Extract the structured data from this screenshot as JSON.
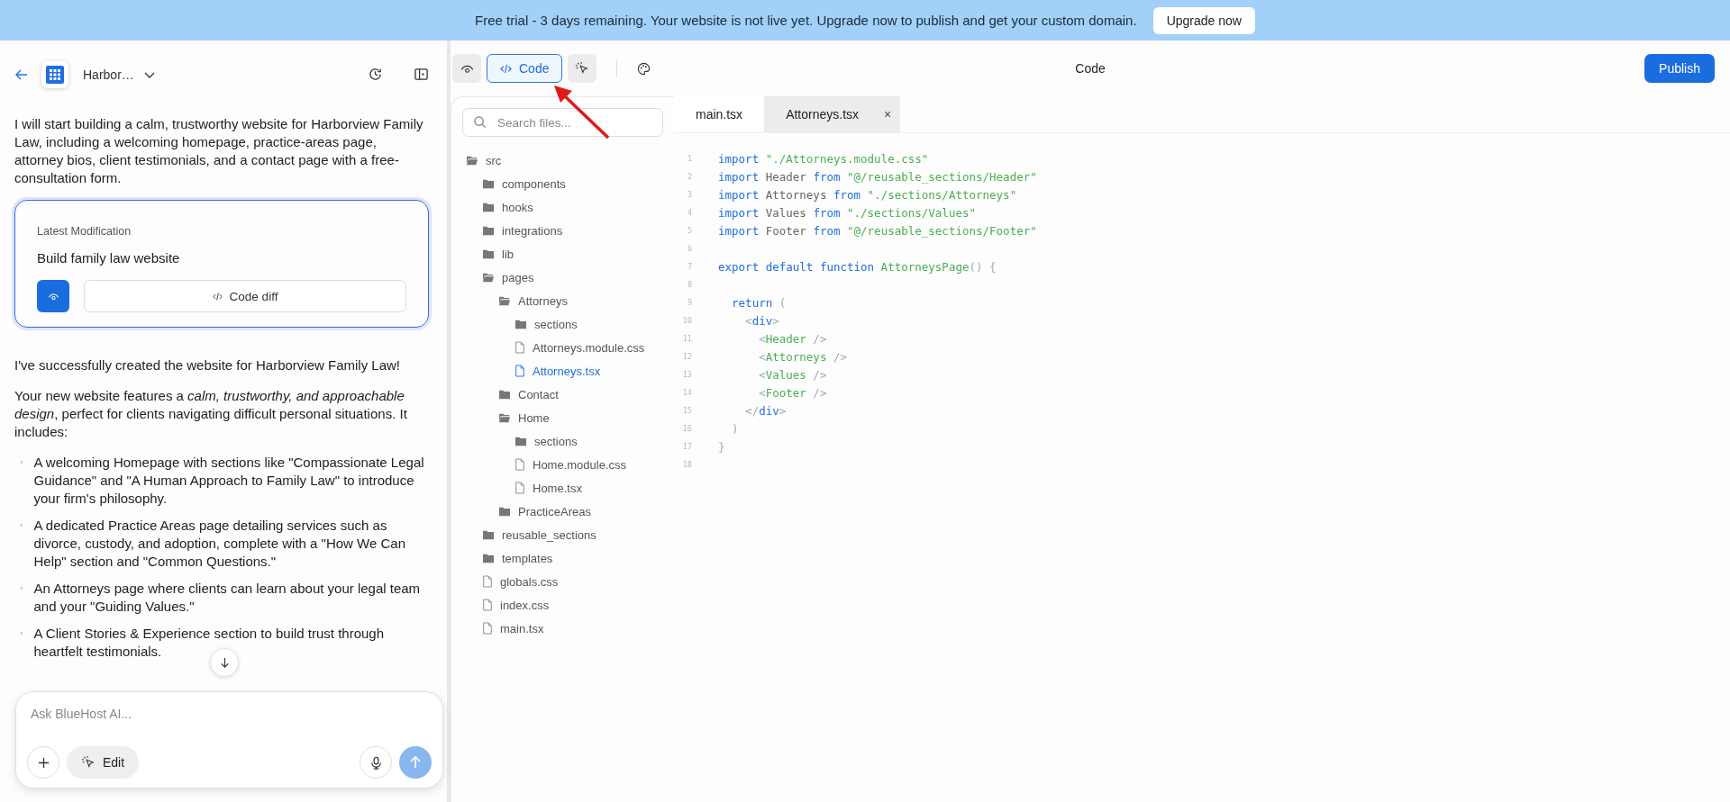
{
  "banner": {
    "message": "Free trial - 3 days remaining. Your website is not live yet. Upgrade now to publish and get your custom domain.",
    "button": "Upgrade now"
  },
  "project": {
    "name": "Harbor…"
  },
  "chat": {
    "intro": "I will start building a calm, trustworthy website for Harborview Family Law, including a welcoming homepage, practice-areas page, attorney bios, client testimonials, and a contact page with a free-consultation form.",
    "modification": {
      "label": "Latest Modification",
      "title": "Build family law website",
      "diff_button": "Code diff"
    },
    "paragraphs": [
      "I've successfully created the website for Harborview Family Law!",
      "Your new website features a *calm, trustworthy, and approachable design*, perfect for clients navigating difficult personal situations. It includes:"
    ],
    "bullet_glyph": "•",
    "bullets": [
      "A welcoming Homepage with sections like \"Compassionate Legal Guidance\" and \"A Human Approach to Family Law\" to introduce your firm's philosophy.",
      "A dedicated Practice Areas page detailing services such as divorce, custody, and adoption, complete with a \"How We Can Help\" section and \"Common Questions.\"",
      "An Attorneys page where clients can learn about your legal team and your \"Guiding Values.\"",
      "A Client Stories & Experience section to build trust through heartfelt testimonials."
    ]
  },
  "composer": {
    "placeholder": "Ask BlueHost AI...",
    "edit_button": "Edit"
  },
  "toolbar": {
    "modes": [
      {
        "kind": "preview",
        "selected": false
      },
      {
        "kind": "code",
        "label": "Code",
        "selected": true
      },
      {
        "kind": "select",
        "selected": false
      }
    ],
    "title": "Code",
    "publish": "Publish"
  },
  "file_search": {
    "placeholder": "Search files..."
  },
  "tree": [
    {
      "name": "src",
      "kind": "folder",
      "expanded": true,
      "selected": false,
      "children": [
        {
          "name": "components",
          "kind": "folder",
          "expanded": false,
          "selected": false
        },
        {
          "name": "hooks",
          "kind": "folder",
          "expanded": false,
          "selected": false
        },
        {
          "name": "integrations",
          "kind": "folder",
          "expanded": false,
          "selected": false
        },
        {
          "name": "lib",
          "kind": "folder",
          "expanded": false,
          "selected": false
        },
        {
          "name": "pages",
          "kind": "folder",
          "expanded": true,
          "selected": false,
          "children": [
            {
              "name": "Attorneys",
              "kind": "folder",
              "expanded": true,
              "selected": false,
              "children": [
                {
                  "name": "sections",
                  "kind": "folder",
                  "expanded": false,
                  "selected": false
                },
                {
                  "name": "Attorneys.module.css",
                  "kind": "file",
                  "selected": false
                },
                {
                  "name": "Attorneys.tsx",
                  "kind": "file",
                  "selected": true
                }
              ]
            },
            {
              "name": "Contact",
              "kind": "folder",
              "expanded": false,
              "selected": false
            },
            {
              "name": "Home",
              "kind": "folder",
              "expanded": true,
              "selected": false,
              "children": [
                {
                  "name": "sections",
                  "kind": "folder",
                  "expanded": false,
                  "selected": false
                },
                {
                  "name": "Home.module.css",
                  "kind": "file",
                  "selected": false
                },
                {
                  "name": "Home.tsx",
                  "kind": "file",
                  "selected": false
                }
              ]
            },
            {
              "name": "PracticeAreas",
              "kind": "folder",
              "expanded": false,
              "selected": false
            }
          ]
        },
        {
          "name": "reusable_sections",
          "kind": "folder",
          "expanded": false,
          "selected": false
        },
        {
          "name": "templates",
          "kind": "folder",
          "expanded": false,
          "selected": false
        },
        {
          "name": "globals.css",
          "kind": "file",
          "selected": false
        },
        {
          "name": "index.css",
          "kind": "file",
          "selected": false
        },
        {
          "name": "main.tsx",
          "kind": "file",
          "selected": false
        }
      ]
    }
  ],
  "editor_tabs": [
    {
      "label": "main.tsx",
      "selected": false,
      "closable": false
    },
    {
      "label": "Attorneys.tsx",
      "selected": true,
      "closable": true
    }
  ],
  "close_glyph": "×",
  "code": [
    {
      "number": "1",
      "tokens": [
        {
          "text": "import",
          "kind": "keyword"
        },
        {
          "text": " \"./Attorneys.module.css\"",
          "kind": "string"
        }
      ]
    },
    {
      "number": "2",
      "tokens": [
        {
          "text": "import",
          "kind": "keyword"
        },
        {
          "text": " Header ",
          "kind": "plain"
        },
        {
          "text": "from",
          "kind": "keyword"
        },
        {
          "text": " \"@/reusable_sections/Header\"",
          "kind": "string"
        }
      ]
    },
    {
      "number": "3",
      "tokens": [
        {
          "text": "import",
          "kind": "keyword"
        },
        {
          "text": " Attorneys ",
          "kind": "plain"
        },
        {
          "text": "from",
          "kind": "keyword"
        },
        {
          "text": " \"./sections/Attorneys\"",
          "kind": "string"
        }
      ]
    },
    {
      "number": "4",
      "tokens": [
        {
          "text": "import",
          "kind": "keyword"
        },
        {
          "text": " Values ",
          "kind": "plain"
        },
        {
          "text": "from",
          "kind": "keyword"
        },
        {
          "text": " \"./sections/Values\"",
          "kind": "string"
        }
      ]
    },
    {
      "number": "5",
      "tokens": [
        {
          "text": "import",
          "kind": "keyword"
        },
        {
          "text": " Footer ",
          "kind": "plain"
        },
        {
          "text": "from",
          "kind": "keyword"
        },
        {
          "text": " \"@/reusable_sections/Footer\"",
          "kind": "string"
        }
      ]
    },
    {
      "number": "6"
    },
    {
      "number": "7",
      "tokens": [
        {
          "text": "export default function",
          "kind": "keyword"
        },
        {
          "text": " AttorneysPage",
          "kind": "string"
        },
        {
          "text": "() {",
          "kind": "punct"
        }
      ]
    },
    {
      "number": "8"
    },
    {
      "number": "9",
      "tokens": [
        {
          "text": "  return",
          "kind": "keyword"
        },
        {
          "text": " (",
          "kind": "punct"
        }
      ]
    },
    {
      "number": "10",
      "tokens": [
        {
          "text": "    <",
          "kind": "punct"
        },
        {
          "text": "div",
          "kind": "keyword"
        },
        {
          "text": ">",
          "kind": "punct"
        }
      ]
    },
    {
      "number": "11",
      "tokens": [
        {
          "text": "      <",
          "kind": "punct"
        },
        {
          "text": "Header",
          "kind": "string"
        },
        {
          "text": " />",
          "kind": "punct"
        }
      ]
    },
    {
      "number": "12",
      "tokens": [
        {
          "text": "      <",
          "kind": "punct"
        },
        {
          "text": "Attorneys",
          "kind": "string"
        },
        {
          "text": " />",
          "kind": "punct"
        }
      ]
    },
    {
      "number": "13",
      "tokens": [
        {
          "text": "      <",
          "kind": "punct"
        },
        {
          "text": "Values",
          "kind": "string"
        },
        {
          "text": " />",
          "kind": "punct"
        }
      ]
    },
    {
      "number": "14",
      "tokens": [
        {
          "text": "      <",
          "kind": "punct"
        },
        {
          "text": "Footer",
          "kind": "string"
        },
        {
          "text": " />",
          "kind": "punct"
        }
      ]
    },
    {
      "number": "15",
      "tokens": [
        {
          "text": "    </",
          "kind": "punct"
        },
        {
          "text": "div",
          "kind": "keyword"
        },
        {
          "text": ">",
          "kind": "punct"
        }
      ]
    },
    {
      "number": "16",
      "tokens": [
        {
          "text": "  )",
          "kind": "punct"
        }
      ]
    },
    {
      "number": "17",
      "tokens": [
        {
          "text": "}",
          "kind": "punct"
        }
      ]
    },
    {
      "number": "18"
    }
  ]
}
